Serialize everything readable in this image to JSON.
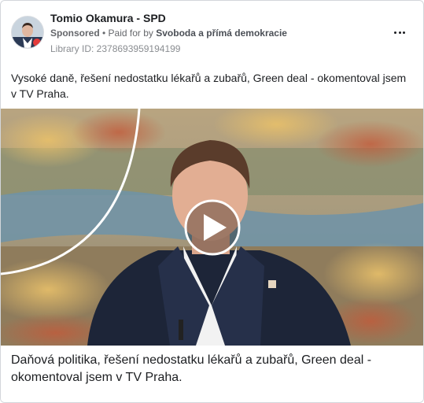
{
  "ad": {
    "page_name": "Tomio Okamura - SPD",
    "sponsored": "Sponsored",
    "separator": " • ",
    "paid_for_by": "Paid for by ",
    "payer": "Svoboda a přímá demokracie",
    "library_id": "Library ID: 2378693959194199",
    "body_text": "Vysoké daně, řešení nedostatku lékařů a zubařů, Green deal - okomentoval jsem v TV Praha.",
    "caption": "Daňová politika, řešení nedostatku lékařů a zubařů, Green deal - okomentoval jsem v TV Praha."
  },
  "icons": {
    "more": "more-options-icon",
    "play": "play-icon"
  },
  "colors": {
    "secondary_text": "#65676b",
    "border": "#d3d6db"
  }
}
